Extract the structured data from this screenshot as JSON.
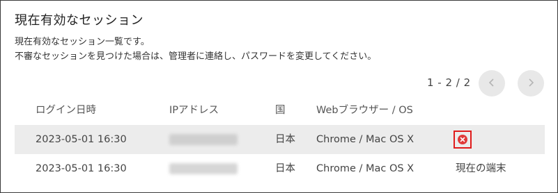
{
  "section": {
    "title": "現在有効なセッション",
    "description_line1": "現在有効なセッション一覧です。",
    "description_line2": "不審なセッションを見つけた場合は、管理者に連絡し、パスワードを変更してください。"
  },
  "pagination": {
    "range_text": "1 - 2 / 2",
    "prev_icon": "chevron-left-icon",
    "next_icon": "chevron-right-icon"
  },
  "table": {
    "headers": {
      "login_datetime": "ログイン日時",
      "ip_address": "IPアドレス",
      "country": "国",
      "browser_os": "Webブラウザー / OS"
    },
    "rows": [
      {
        "login_datetime": "2023-05-01 16:30",
        "ip_address": "",
        "country": "日本",
        "browser_os": "Chrome / Mac OS X",
        "action_icon": "close-circle-icon"
      },
      {
        "login_datetime": "2023-05-01 16:30",
        "ip_address": "",
        "country": "日本",
        "browser_os": "Chrome / Mac OS X",
        "status": "現在の端末"
      }
    ]
  },
  "colors": {
    "highlight_row": "#ececec",
    "revoke_red": "#e03a3a",
    "pager_button": "#e8e8e8"
  }
}
